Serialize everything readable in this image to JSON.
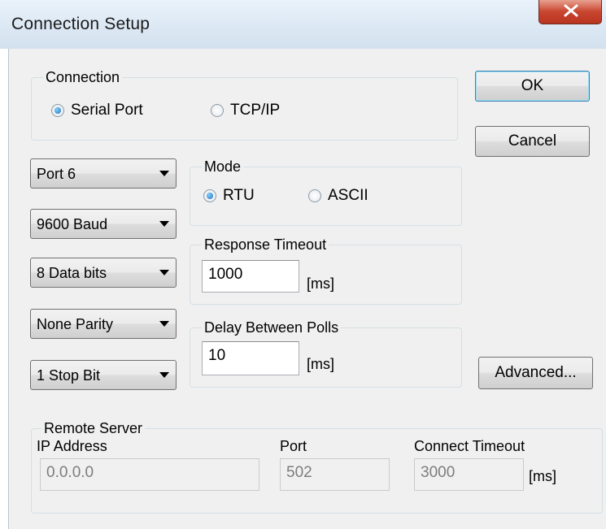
{
  "window": {
    "title": "Connection Setup",
    "close_glyph": "X"
  },
  "connection": {
    "legend": "Connection",
    "options": [
      {
        "label": "Serial Port",
        "selected": true
      },
      {
        "label": "TCP/IP",
        "selected": false
      }
    ]
  },
  "buttons": {
    "ok": "OK",
    "cancel": "Cancel",
    "advanced": "Advanced..."
  },
  "serial": {
    "port": "Port 6",
    "baud": "9600 Baud",
    "data_bits": "8 Data bits",
    "parity": "None Parity",
    "stop_bits": "1 Stop Bit"
  },
  "mode": {
    "legend": "Mode",
    "options": [
      {
        "label": "RTU",
        "selected": true
      },
      {
        "label": "ASCII",
        "selected": false
      }
    ]
  },
  "response_timeout": {
    "legend": "Response Timeout",
    "value": "1000",
    "unit": "[ms]"
  },
  "delay_between_polls": {
    "legend": "Delay Between Polls",
    "value": "10",
    "unit": "[ms]"
  },
  "remote_server": {
    "legend": "Remote Server",
    "ip_label": "IP Address",
    "ip_value": "0.0.0.0",
    "port_label": "Port",
    "port_value": "502",
    "timeout_label": "Connect Timeout",
    "timeout_value": "3000",
    "timeout_unit": "[ms]"
  },
  "colors": {
    "dialog_bg": "#f0f0f0",
    "radio_selected": "#1670c8",
    "close_button": "#c8452f",
    "default_button_border": "#3c7fb1"
  }
}
